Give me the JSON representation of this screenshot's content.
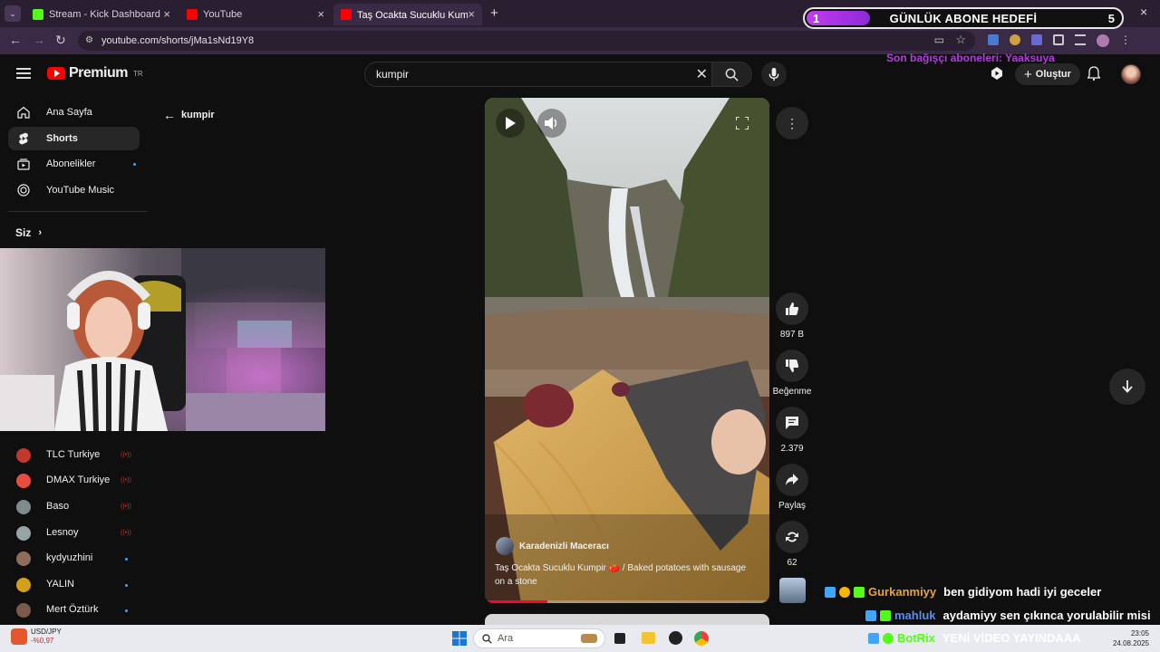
{
  "browser": {
    "tabs": [
      {
        "title": "Stream - Kick Dashboard",
        "favicon_color": "#53fc18"
      },
      {
        "title": "YouTube",
        "favicon_color": "#ff0000"
      },
      {
        "title": "Taş Ocakta Sucuklu Kumpir 🍅 / B",
        "favicon_color": "#ff0000"
      }
    ],
    "new_tab": "+",
    "url": "youtube.com/shorts/jMa1sNd19Y8"
  },
  "goal": {
    "current": "1",
    "label": "GÜNLÜK ABONE HEDEFİ",
    "target": "5",
    "progress": 0.2
  },
  "donor": "Son bağışçı aboneleri: Yaaksuya",
  "header": {
    "logo": "Premium",
    "region": "TR",
    "search_value": "kumpir",
    "create_label": "Oluştur"
  },
  "sidebar": {
    "nav": [
      {
        "label": "Ana Sayfa",
        "icon": "home-icon"
      },
      {
        "label": "Shorts",
        "icon": "shorts-icon"
      },
      {
        "label": "Abonelikler",
        "icon": "subscriptions-icon"
      },
      {
        "label": "YouTube Music",
        "icon": "music-icon"
      }
    ],
    "you_label": "Siz",
    "subscriptions": [
      {
        "name": "TLC Turkiye",
        "color": "#c0392b",
        "status": "live"
      },
      {
        "name": "DMAX Turkiye",
        "color": "#e74c3c",
        "status": "live"
      },
      {
        "name": "Baso",
        "color": "#7f8c8d",
        "status": "live"
      },
      {
        "name": "Lesnoy",
        "color": "#95a5a6",
        "status": "live"
      },
      {
        "name": "kydyuzhini",
        "color": "#8e6e5a",
        "status": "dot"
      },
      {
        "name": "YALIN",
        "color": "#d4a017",
        "status": "dot"
      },
      {
        "name": "Mert Öztürk",
        "color": "#7a5a4a",
        "status": "dot"
      }
    ]
  },
  "shorts": {
    "back_label": "kumpir",
    "channel": "Karadenizli Maceracı",
    "title": "Taş Ocakta Sucuklu Kumpir 🍅 / Baked potatoes with sausage on a stone",
    "progress": 0.22,
    "actions": [
      {
        "label": "897 B",
        "icon": "like-icon"
      },
      {
        "label": "Beğenme",
        "icon": "dislike-icon"
      },
      {
        "label": "2.379",
        "icon": "comment-icon"
      },
      {
        "label": "Paylaş",
        "icon": "share-icon"
      },
      {
        "label": "62",
        "icon": "remix-icon"
      }
    ]
  },
  "chat": [
    {
      "user": "Gurkanmiyy",
      "user_color": "#e8a23a",
      "message": "ben gidiyom hadi iyi geceler"
    },
    {
      "user": "mahluk",
      "user_color": "#5b8def",
      "message": "aydamiyy sen çıkınca yorulabilir misi"
    },
    {
      "user": "BotRix",
      "user_color": "#53fc18",
      "message": "YENİ VİDEO YAYINDAAA"
    }
  ],
  "taskbar": {
    "ticker_pair": "USD/JPY",
    "ticker_change": "-%0,97",
    "search_placeholder": "Ara",
    "time": "23:05",
    "date": "24.08.2025"
  }
}
